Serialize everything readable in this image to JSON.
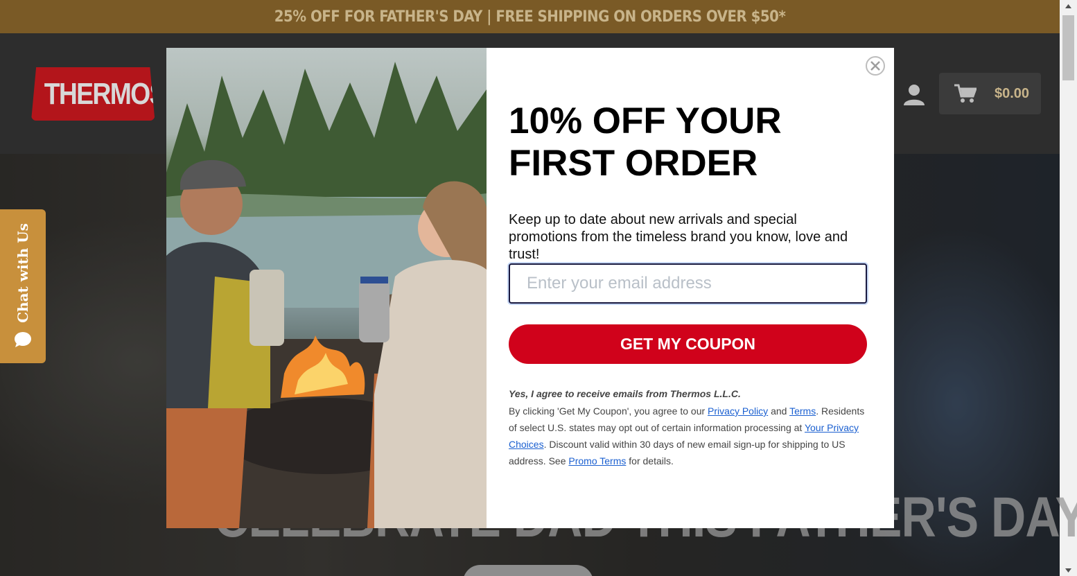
{
  "promo_bar": {
    "text": "25% OFF FOR FATHER'S DAY | FREE SHIPPING ON ORDERS OVER $50*"
  },
  "header": {
    "logo_text": "THERMOS.",
    "cart_total": "$0.00",
    "icons": {
      "account": "user-icon",
      "cart": "cart-icon"
    }
  },
  "hero": {
    "title": "CELEBRATE DAD THIS FATHER'S DAY"
  },
  "chat_tab": {
    "label": "Chat with Us",
    "icon": "chat-bubble-icon"
  },
  "modal": {
    "heading": "10% OFF YOUR FIRST ORDER",
    "subtext": "Keep up to date about new arrivals and special promotions from the timeless brand you know, love and trust!",
    "email_placeholder": "Enter your email address",
    "button_label": "GET MY COUPON",
    "consent_heading": "Yes, I agree to receive emails from Thermos L.L.C.",
    "legal": {
      "part1": "By clicking 'Get My Coupon', you agree to our ",
      "privacy_link": "Privacy Policy",
      "and": " and ",
      "terms_link": "Terms",
      "part2": ". Residents of select U.S. states may opt out of certain information processing at ",
      "choices_link": "Your Privacy Choices",
      "part3": ". Discount valid within 30 days of new email sign-up for shipping to US address. See ",
      "promo_link": "Promo Terms",
      "part4": " for details."
    }
  },
  "colors": {
    "brand_red": "#d0021b",
    "promo_bar": "#7a5a26",
    "chat_tab": "#c8903c"
  }
}
